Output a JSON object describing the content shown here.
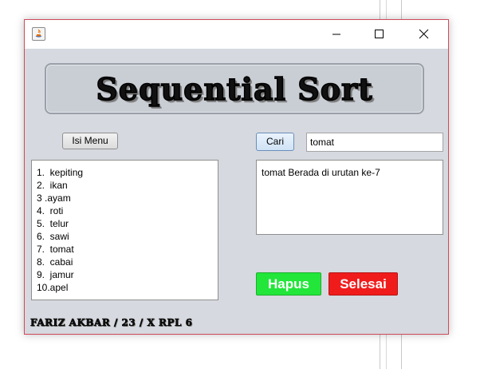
{
  "window": {
    "icon": "java-icon",
    "controls": [
      "minimize-icon",
      "maximize-icon",
      "close-icon"
    ]
  },
  "banner": {
    "title": "Sequential Sort"
  },
  "buttons": {
    "isi_menu": "Isi Menu",
    "cari": "Cari",
    "hapus": "Hapus",
    "selesai": "Selesai"
  },
  "search": {
    "value": "tomat"
  },
  "list": {
    "items": [
      "1.  kepiting",
      "2.  ikan",
      "3 .ayam",
      "4.  roti",
      "5.  telur",
      "6.  sawi",
      "7.  tomat",
      "8.  cabai",
      "9.  jamur",
      "10.apel"
    ]
  },
  "result": {
    "text": "tomat Berada di urutan ke-7"
  },
  "footer": {
    "text": "FARIZ AKBAR / 23 / X RPL 6"
  },
  "colors": {
    "hapus": "#22e63a",
    "selesai": "#f01c1c",
    "window_bg": "#d6d9df",
    "window_border": "#cf4a5b"
  }
}
